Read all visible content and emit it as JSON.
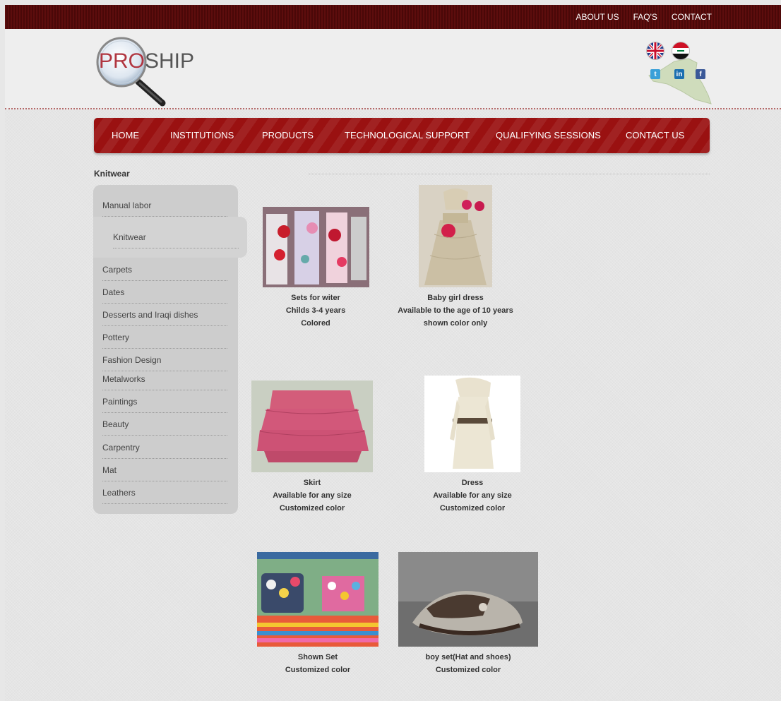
{
  "topnav": {
    "about": "ABOUT US",
    "faq": "FAQ'S",
    "contact": "CONTACT"
  },
  "logo": {
    "pro": "PRO",
    "ship": "SHIP"
  },
  "mainnav": [
    "HOME",
    "INSTITUTIONS",
    "PRODUCTS",
    "TECHNOLOGICAL SUPPORT",
    "QUALIFYING SESSIONS",
    "CONTACT US"
  ],
  "page_title": "Knitwear",
  "sidebar": {
    "items": [
      "Manual labor",
      "Knitwear",
      "Carpets",
      "Dates",
      "Desserts and Iraqi dishes",
      "Pottery",
      "Fashion Design",
      "Metalworks",
      "Paintings",
      "Beauty",
      "Carpentry",
      "Mat",
      "Leathers"
    ],
    "active": "Knitwear"
  },
  "products": [
    {
      "name": "Sets for witer",
      "line2": "Childs 3-4 years",
      "line3": "Colored"
    },
    {
      "name": "Baby girl dress",
      "line2": "Available to the age of 10 years",
      "line3": "shown color only"
    },
    {
      "name": "Skirt",
      "line2": "Available for any size",
      "line3": "Customized color"
    },
    {
      "name": "Dress",
      "line2": "Available for any size",
      "line3": "Customized color"
    },
    {
      "name": "Shown Set",
      "line2": "Customized color"
    },
    {
      "name": "boy set(Hat and shoes)",
      "line2": "Customized color"
    }
  ],
  "colors": {
    "topbar": "#4a0808",
    "mainnav": "#9a1111",
    "logo_accent": "#b03540",
    "sidebar": "#cdcdcd"
  }
}
